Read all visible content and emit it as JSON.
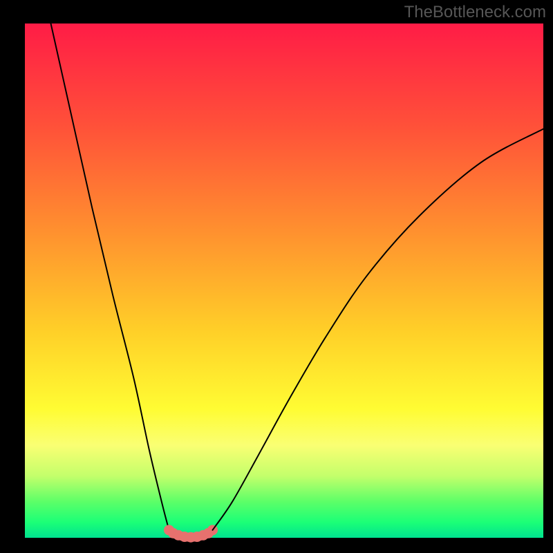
{
  "watermark": "TheBottleneck.com",
  "chart_data": {
    "type": "line",
    "title": "",
    "xlabel": "",
    "ylabel": "",
    "xlim": [
      0,
      100
    ],
    "ylim": [
      0,
      100
    ],
    "grid": false,
    "gradient_stops": [
      {
        "offset": 0.0,
        "color": "#ff1c46"
      },
      {
        "offset": 0.2,
        "color": "#ff5139"
      },
      {
        "offset": 0.4,
        "color": "#ff8f2f"
      },
      {
        "offset": 0.6,
        "color": "#ffd028"
      },
      {
        "offset": 0.75,
        "color": "#fffc33"
      },
      {
        "offset": 0.82,
        "color": "#faff73"
      },
      {
        "offset": 0.88,
        "color": "#c3ff6b"
      },
      {
        "offset": 0.93,
        "color": "#5cff68"
      },
      {
        "offset": 0.97,
        "color": "#1bff77"
      },
      {
        "offset": 1.0,
        "color": "#00e28f"
      }
    ],
    "series": [
      {
        "name": "curve-left",
        "stroke": "#000000",
        "x": [
          5.0,
          9.0,
          13.0,
          17.0,
          21.0,
          24.0,
          26.5,
          27.8
        ],
        "y": [
          100.0,
          82.0,
          64.0,
          47.0,
          31.0,
          17.0,
          6.5,
          1.5
        ]
      },
      {
        "name": "dots-left",
        "stroke": "#e7716e",
        "marker": true,
        "x": [
          27.8,
          28.6,
          29.6,
          30.8,
          32.0,
          33.2,
          34.4,
          35.4,
          36.2
        ],
        "y": [
          1.5,
          0.9,
          0.5,
          0.2,
          0.1,
          0.2,
          0.5,
          0.9,
          1.5
        ]
      },
      {
        "name": "curve-right",
        "stroke": "#000000",
        "x": [
          36.2,
          40.0,
          45.0,
          51.0,
          58.0,
          66.0,
          76.0,
          88.0,
          100.0
        ],
        "y": [
          1.5,
          7.0,
          16.0,
          27.0,
          39.0,
          51.0,
          62.5,
          73.0,
          79.5
        ]
      }
    ]
  }
}
